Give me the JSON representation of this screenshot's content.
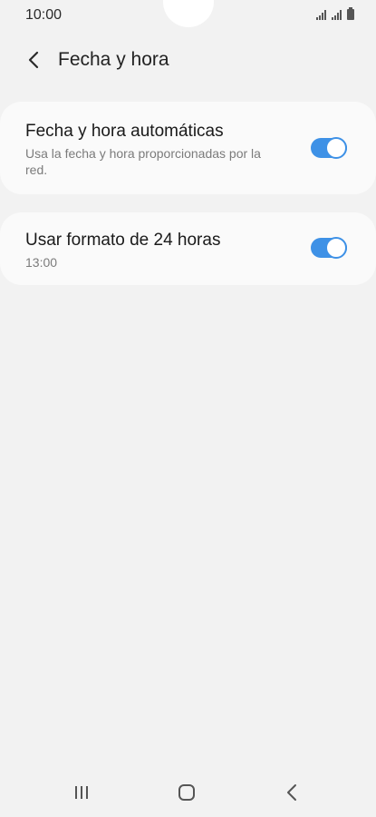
{
  "status_bar": {
    "time": "10:00",
    "icons": [
      "signal-icon",
      "signal-icon",
      "battery-icon"
    ]
  },
  "header": {
    "back_icon": "chevron-left-icon",
    "title": "Fecha y hora"
  },
  "settings": [
    {
      "title": "Fecha y hora automáticas",
      "subtitle": "Usa la fecha y hora proporcionadas por la red.",
      "enabled": true
    },
    {
      "title": "Usar formato de 24 horas",
      "subtitle": "13:00",
      "enabled": true
    }
  ],
  "colors": {
    "background": "#f2f2f2",
    "card": "#fafafa",
    "accent": "#3e91e6"
  },
  "nav_bar": {
    "icons": [
      "recents-icon",
      "home-icon",
      "back-icon"
    ]
  }
}
